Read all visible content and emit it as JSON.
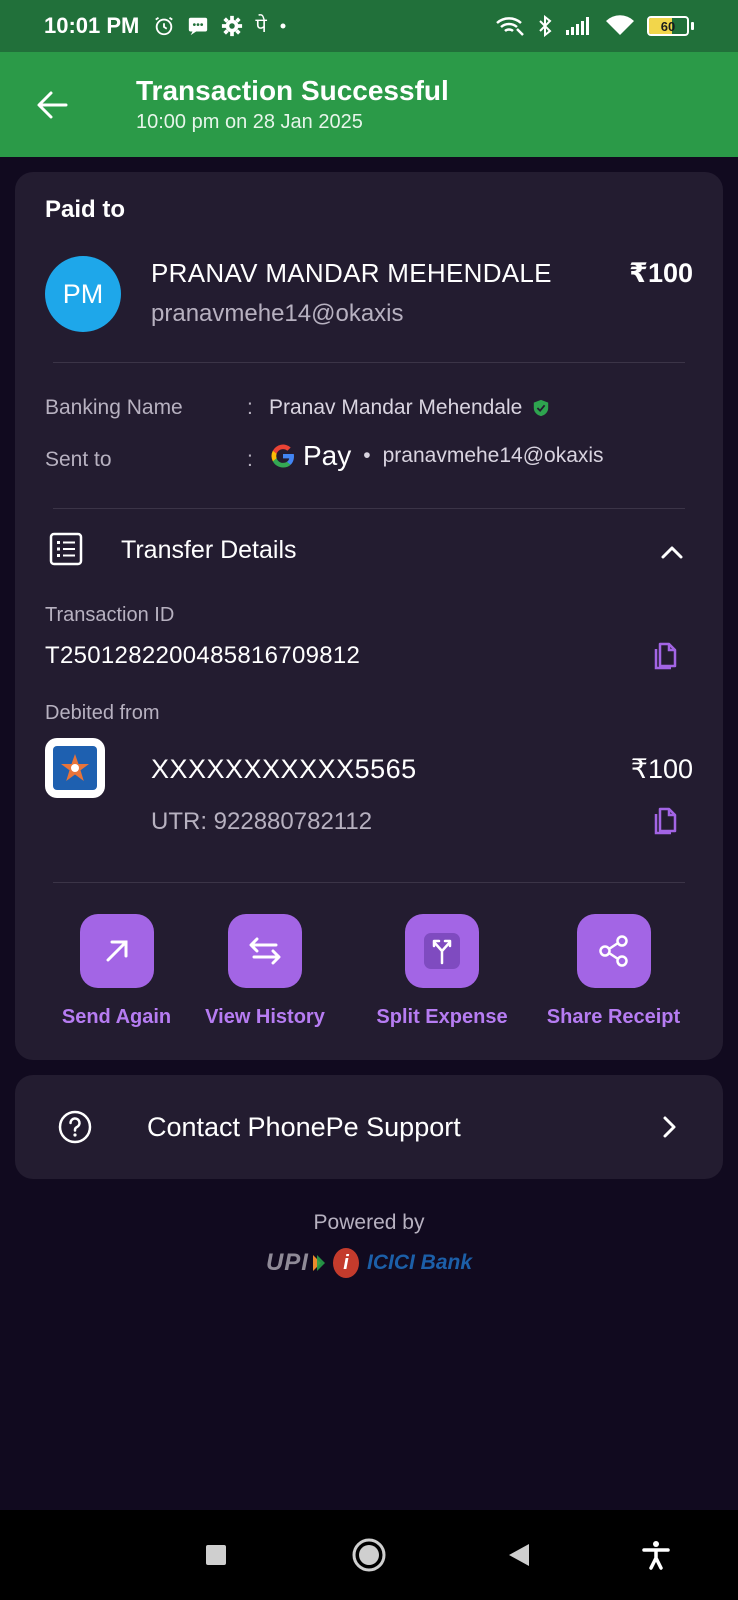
{
  "status_bar": {
    "time": "10:01 PM",
    "left_icons": [
      "alarm-icon",
      "message-icon",
      "settings-icon",
      "phonepe-notification-icon",
      "dot-icon"
    ],
    "phonepe_glyph": "पे",
    "right_icons": [
      "wifi-calling-icon",
      "bluetooth-icon",
      "cellular-signal-icon",
      "wifi-icon",
      "battery-icon"
    ],
    "battery_level": "60"
  },
  "header": {
    "title": "Transaction Successful",
    "subtitle": "10:00 pm on 28 Jan 2025",
    "background_color": "#2b9a48"
  },
  "paid_to": {
    "heading": "Paid to",
    "avatar_initials": "PM",
    "name": "PRANAV MANDAR MEHENDALE",
    "upi_id": "pranavmehe14@okaxis",
    "amount": "₹100"
  },
  "details": {
    "banking_name_label": "Banking Name",
    "banking_name_value": "Pranav Mandar Mehendale",
    "sent_to_label": "Sent to",
    "sent_to_app": "Pay",
    "sent_to_upi": "pranavmehe14@okaxis",
    "separator": ":"
  },
  "transfer": {
    "title": "Transfer Details",
    "transaction_id_label": "Transaction ID",
    "transaction_id": "T2501282200485816709812",
    "debited_from_label": "Debited from",
    "account_number": "XXXXXXXXXXX5565",
    "account_amount": "₹100",
    "utr": "UTR: 922880782112"
  },
  "actions": [
    {
      "label": "Send Again",
      "icon": "arrow-up-right-icon"
    },
    {
      "label": "View History",
      "icon": "swap-arrows-icon"
    },
    {
      "label": "Split Expense",
      "icon": "split-icon"
    },
    {
      "label": "Share Receipt",
      "icon": "share-icon"
    }
  ],
  "support": {
    "label": "Contact PhonePe Support"
  },
  "footer": {
    "powered_by": "Powered by",
    "upi_text": "UPI",
    "bank_text": "ICICI Bank",
    "bank_i": "i"
  },
  "colors": {
    "accent_purple": "#a365e5",
    "action_label": "#b67cf2",
    "card_bg": "#231c30",
    "page_bg": "#110a1f",
    "avatar_bg": "#1ea7ea",
    "status_bar": "#21703a"
  }
}
